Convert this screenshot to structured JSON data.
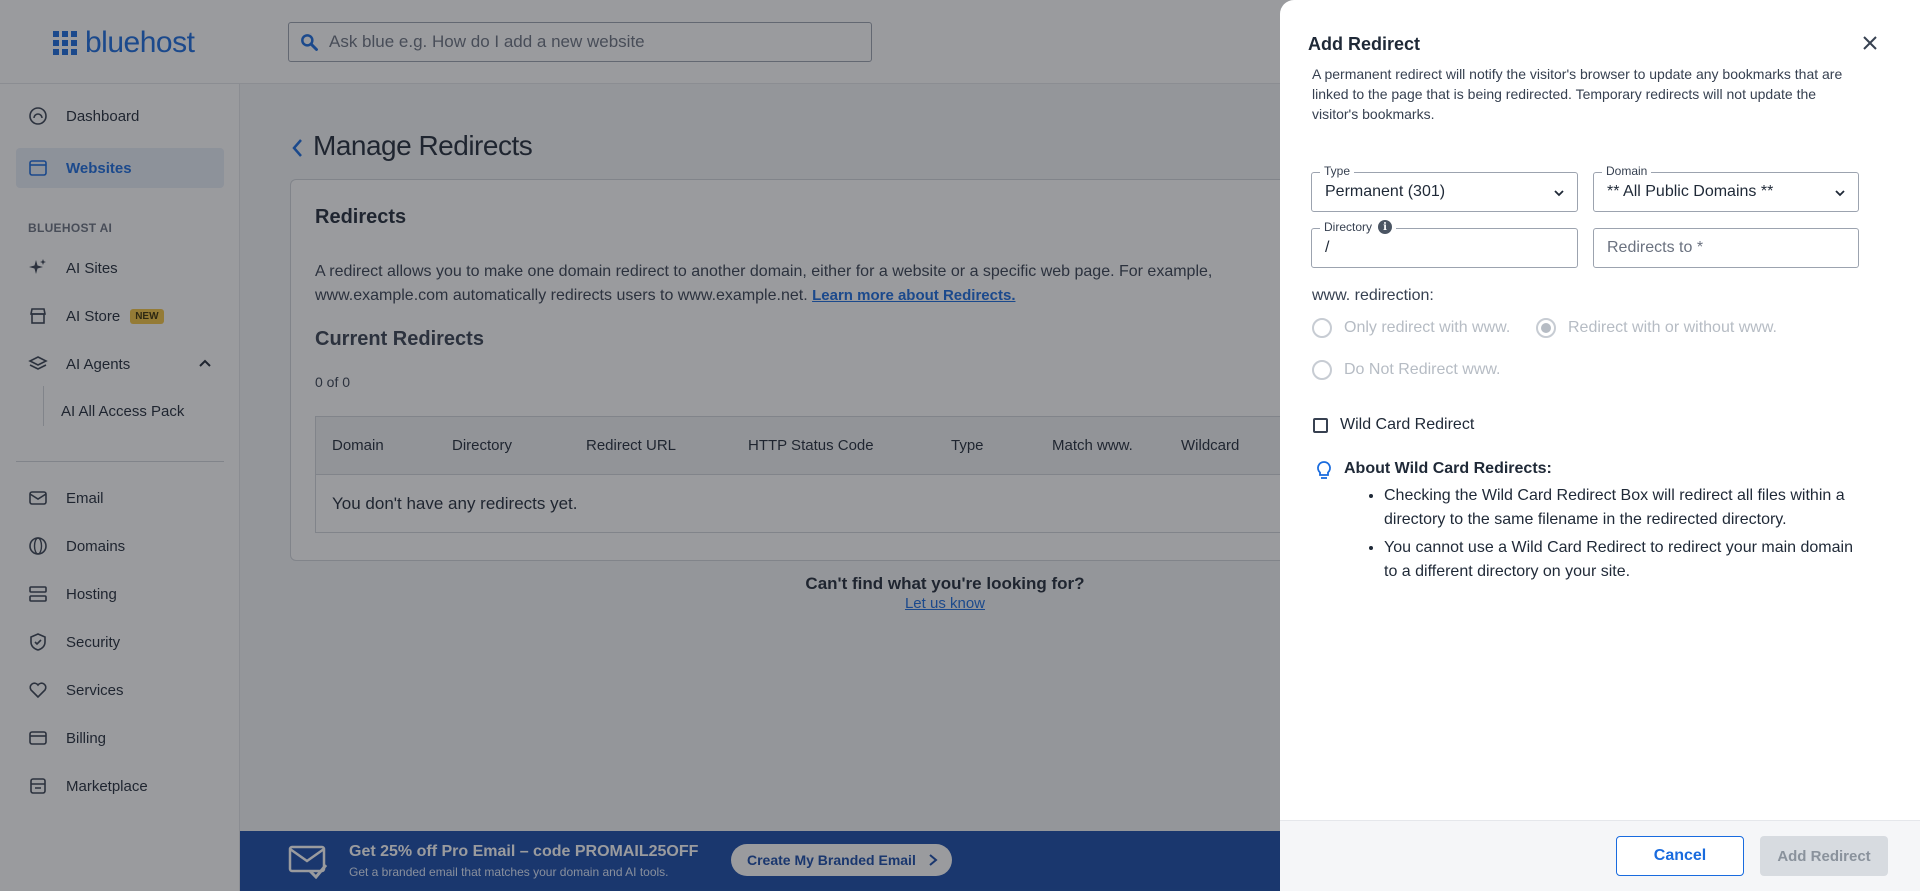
{
  "brand": {
    "name": "bluehost",
    "accent": "#196bde"
  },
  "search": {
    "placeholder": "Ask blue e.g. How do I add a new website"
  },
  "sidebar": {
    "items_top": [
      {
        "label": "Dashboard",
        "icon": "dashboard-icon"
      },
      {
        "label": "Websites",
        "icon": "websites-icon",
        "active": true
      }
    ],
    "section_ai": "BLUEHOST AI",
    "items_ai": [
      {
        "label": "AI Sites",
        "icon": "sparkle-icon"
      },
      {
        "label": "AI Store",
        "icon": "store-icon",
        "badge": "NEW"
      },
      {
        "label": "AI Agents",
        "icon": "layers-icon"
      }
    ],
    "sub_item": "AI All Access Pack",
    "items_bottom": [
      {
        "label": "Email",
        "icon": "email-icon"
      },
      {
        "label": "Domains",
        "icon": "globe-icon"
      },
      {
        "label": "Hosting",
        "icon": "hosting-icon"
      },
      {
        "label": "Security",
        "icon": "shield-icon"
      },
      {
        "label": "Services",
        "icon": "services-icon"
      },
      {
        "label": "Billing",
        "icon": "billing-icon"
      },
      {
        "label": "Marketplace",
        "icon": "marketplace-icon"
      }
    ]
  },
  "main": {
    "title": "Manage Redirects",
    "card": {
      "heading": "Redirects",
      "description": "A redirect allows you to make one domain redirect to another domain, either for a website or a specific web page. For example, www.example.com automatically redirects users to www.example.net.",
      "learn_more": "Learn more about Redirects.",
      "current_heading": "Current Redirects",
      "count": "0 of 0",
      "columns": [
        "Domain",
        "Directory",
        "Redirect URL",
        "HTTP Status Code",
        "Type",
        "Match www.",
        "Wildcard"
      ],
      "empty": "You don't have any redirects yet."
    },
    "cant_find": "Can't find what you're looking for?",
    "let_us_know": "Let us know"
  },
  "banner": {
    "title": "Get 25% off Pro Email – code PROMAIL25OFF",
    "subtitle": "Get a branded email that matches your domain and AI tools.",
    "cta": "Create My Branded Email"
  },
  "drawer": {
    "title": "Add Redirect",
    "description": "A permanent redirect will notify the visitor's browser to update any bookmarks that are linked to the page that is being redirected. Temporary redirects will not update the visitor's bookmarks.",
    "type_label": "Type",
    "type_value": "Permanent (301)",
    "domain_label": "Domain",
    "domain_value": "** All Public Domains **",
    "directory_label": "Directory",
    "directory_value": "/",
    "redirects_to_placeholder": "Redirects to *",
    "www_label": "www. redirection:",
    "www_options": [
      "Only redirect with www.",
      "Redirect with or without www.",
      "Do Not Redirect www."
    ],
    "www_selected": 1,
    "wildcard_label": "Wild Card Redirect",
    "about_title": "About Wild Card Redirects:",
    "about_points": [
      "Checking the Wild Card Redirect Box will redirect all files within a directory to the same filename in the redirected directory.",
      "You cannot use a Wild Card Redirect to redirect your main domain to a different directory on your site."
    ],
    "cancel": "Cancel",
    "submit": "Add Redirect"
  }
}
